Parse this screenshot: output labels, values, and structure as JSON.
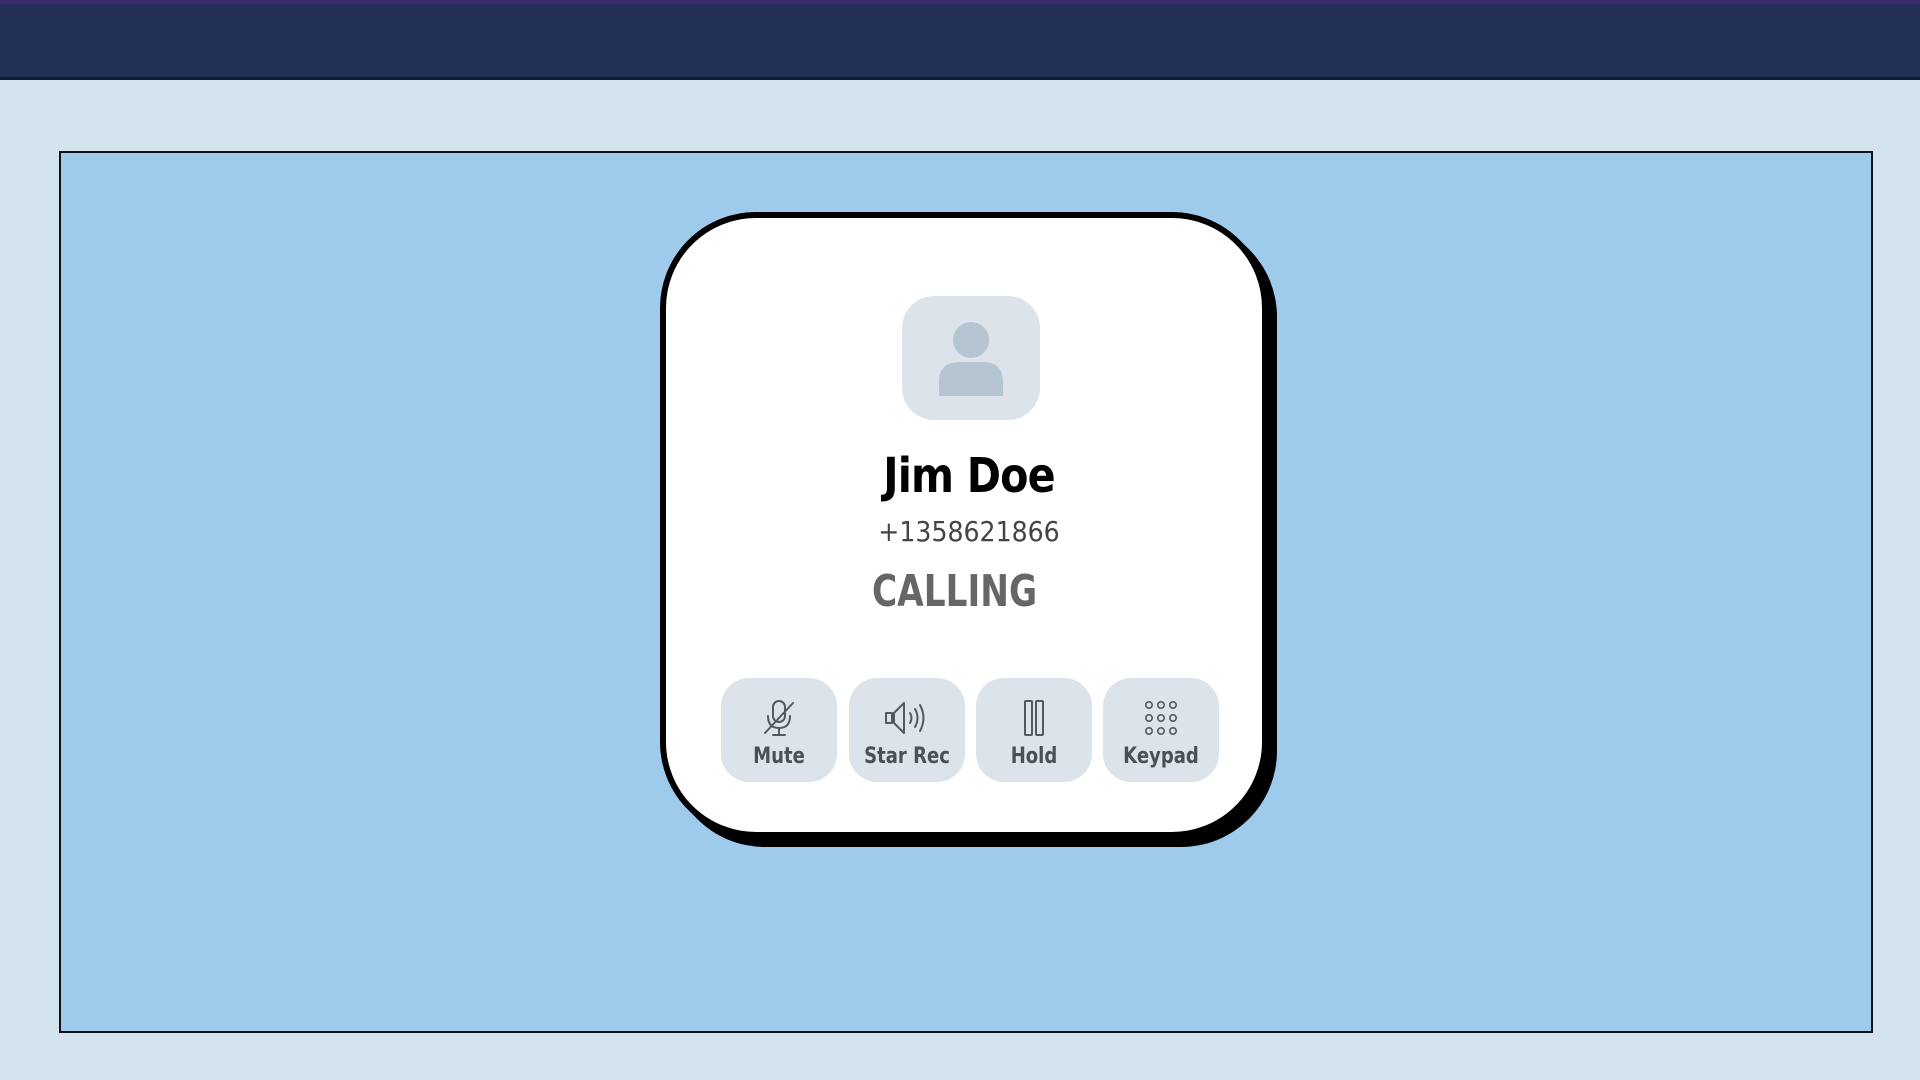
{
  "call": {
    "name": "Jim Doe",
    "number": "+1358621866",
    "status": "CALLING"
  },
  "actions": [
    {
      "label": "Mute",
      "icon": "microphone-muted-icon"
    },
    {
      "label": "Star Rec",
      "icon": "speaker-icon"
    },
    {
      "label": "Hold",
      "icon": "pause-icon"
    },
    {
      "label": "Keypad",
      "icon": "keypad-icon"
    }
  ],
  "colors": {
    "topbar": "#223055",
    "background": "#d3e4ef",
    "stage": "#9ecaec",
    "card": "#ffffff",
    "button": "#dde3ea",
    "avatar_figure": "#b5c5d2"
  }
}
